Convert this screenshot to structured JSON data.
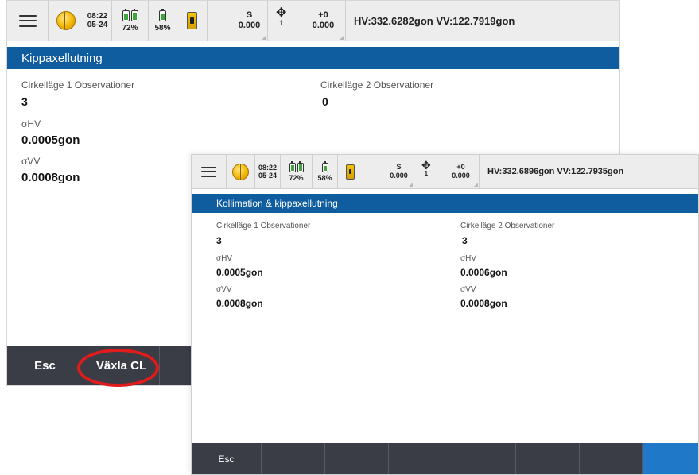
{
  "back_screen": {
    "status": {
      "time": "08:22",
      "date": "05-24",
      "battery1_pct": "72%",
      "battery2_pct": "58%",
      "mode_label": "S",
      "mode_value": "0.000",
      "prism_count": "1",
      "offset_label": "+0",
      "offset_value": "0.000",
      "angles": "HV:332.6282gon  VV:122.7919gon"
    },
    "title": "Kippaxellutning",
    "col1": {
      "label": "Cirkelläge 1 Observationer",
      "value": "3"
    },
    "col2": {
      "label": "Cirkelläge 2 Observationer",
      "value": "0"
    },
    "shv": {
      "label": "σHV",
      "value": "0.0005gon"
    },
    "svv": {
      "label": "σVV",
      "value": "0.0008gon"
    },
    "softkeys": {
      "esc": "Esc",
      "switch": "Växla CL"
    }
  },
  "front_screen": {
    "status": {
      "time": "08:22",
      "date": "05-24",
      "battery1_pct": "72%",
      "battery2_pct": "58%",
      "mode_label": "S",
      "mode_value": "0.000",
      "prism_count": "1",
      "offset_label": "+0",
      "offset_value": "0.000",
      "angles": "HV:332.6896gon  VV:122.7935gon"
    },
    "title": "Kollimation & kippaxellutning",
    "left": {
      "obs_label": "Cirkelläge 1 Observationer",
      "obs_value": "3",
      "shv_label": "σHV",
      "shv_value": "0.0005gon",
      "svv_label": "σVV",
      "svv_value": "0.0008gon"
    },
    "right": {
      "obs_label": "Cirkelläge 2 Observationer",
      "obs_value": "3",
      "shv_label": "σHV",
      "shv_value": "0.0006gon",
      "svv_label": "σVV",
      "svv_value": "0.0008gon"
    },
    "softkeys": {
      "esc": "Esc"
    }
  },
  "colors": {
    "title_bar": "#0f5c9e",
    "bottom_bar": "#3a3d46",
    "accent_key": "#1f78c8",
    "highlight": "#e01b1b"
  }
}
